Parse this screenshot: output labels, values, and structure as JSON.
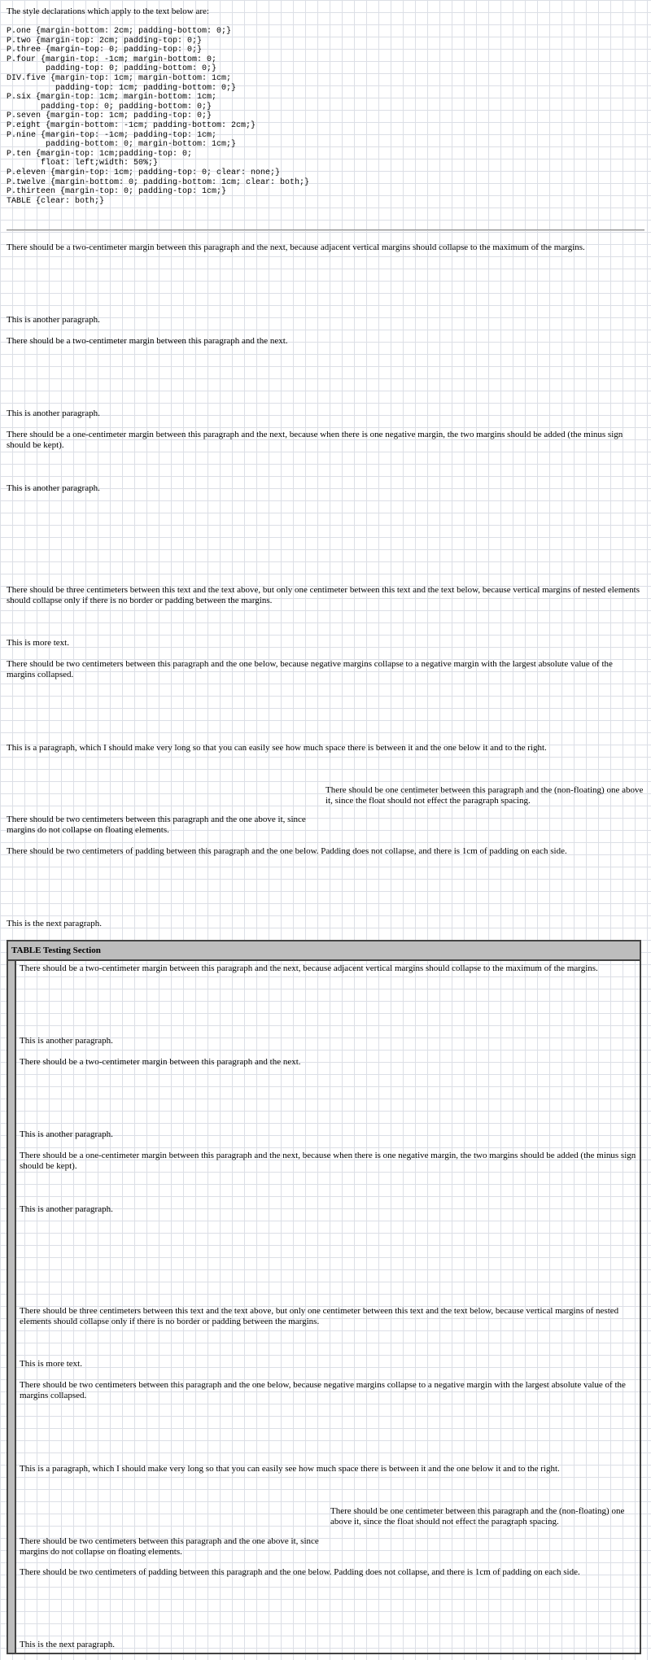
{
  "intro": "The style declarations which apply to the text below are:",
  "css_code": "P.one {margin-bottom: 2cm; padding-bottom: 0;}\nP.two {margin-top: 2cm; padding-top: 0;}\nP.three {margin-top: 0; padding-top: 0;}\nP.four {margin-top: -1cm; margin-bottom: 0;\n        padding-top: 0; padding-bottom: 0;}\nDIV.five {margin-top: 1cm; margin-bottom: 1cm;\n          padding-top: 1cm; padding-bottom: 0;}\nP.six {margin-top: 1cm; margin-bottom: 1cm;\n       padding-top: 0; padding-bottom: 0;}\nP.seven {margin-top: 1cm; padding-top: 0;}\nP.eight {margin-bottom: -1cm; padding-bottom: 2cm;}\nP.nine {margin-top: -1cm; padding-top: 1cm;\n        padding-bottom: 0; margin-bottom: 1cm;}\nP.ten {margin-top: 1cm;padding-top: 0;\n       float: left;width: 50%;}\nP.eleven {margin-top: 1cm; padding-top: 0; clear: none;}\nP.twelve {margin-bottom: 0; padding-bottom: 1cm; clear: both;}\nP.thirteen {margin-top: 0; padding-top: 1cm;}\nTABLE {clear: both;}",
  "paragraphs": {
    "p1": "There should be a two-centimeter margin between this paragraph and the next, because adjacent vertical margins should collapse to the maximum of the margins.",
    "p2": "This is another paragraph.",
    "p3": "There should be a two-centimeter margin between this paragraph and the next.",
    "p4": "This is another paragraph.",
    "p5": "There should be a one-centimeter margin between this paragraph and the next, because when there is one negative margin, the two margins should be added (the minus sign should be kept).",
    "p6": "This is another paragraph.",
    "p7": "There should be three centimeters between this text and the text above, but only one centimeter between this text and the text below, because vertical margins of nested elements should collapse only if there is no border or padding between the margins.",
    "p8": "This is more text.",
    "p9": "There should be two centimeters between this paragraph and the one below, because negative margins collapse to a negative margin with the largest absolute value of the margins collapsed.",
    "p10": "This is a paragraph, which I should make very long so that you can easily see how much space there is between it and the one below it and to the right.",
    "p11": "There should be two centimeters between this paragraph and the one above it, since margins do not collapse on floating elements.",
    "p12": "There should be one centimeter between this paragraph and the (non-floating) one above it, since the float should not effect the paragraph spacing.",
    "p13": "There should be two centimeters of padding between this paragraph and the one below. Padding does not collapse, and there is 1cm of padding on each side.",
    "p14": "This is the next paragraph."
  },
  "table": {
    "title": "TABLE Testing Section"
  }
}
